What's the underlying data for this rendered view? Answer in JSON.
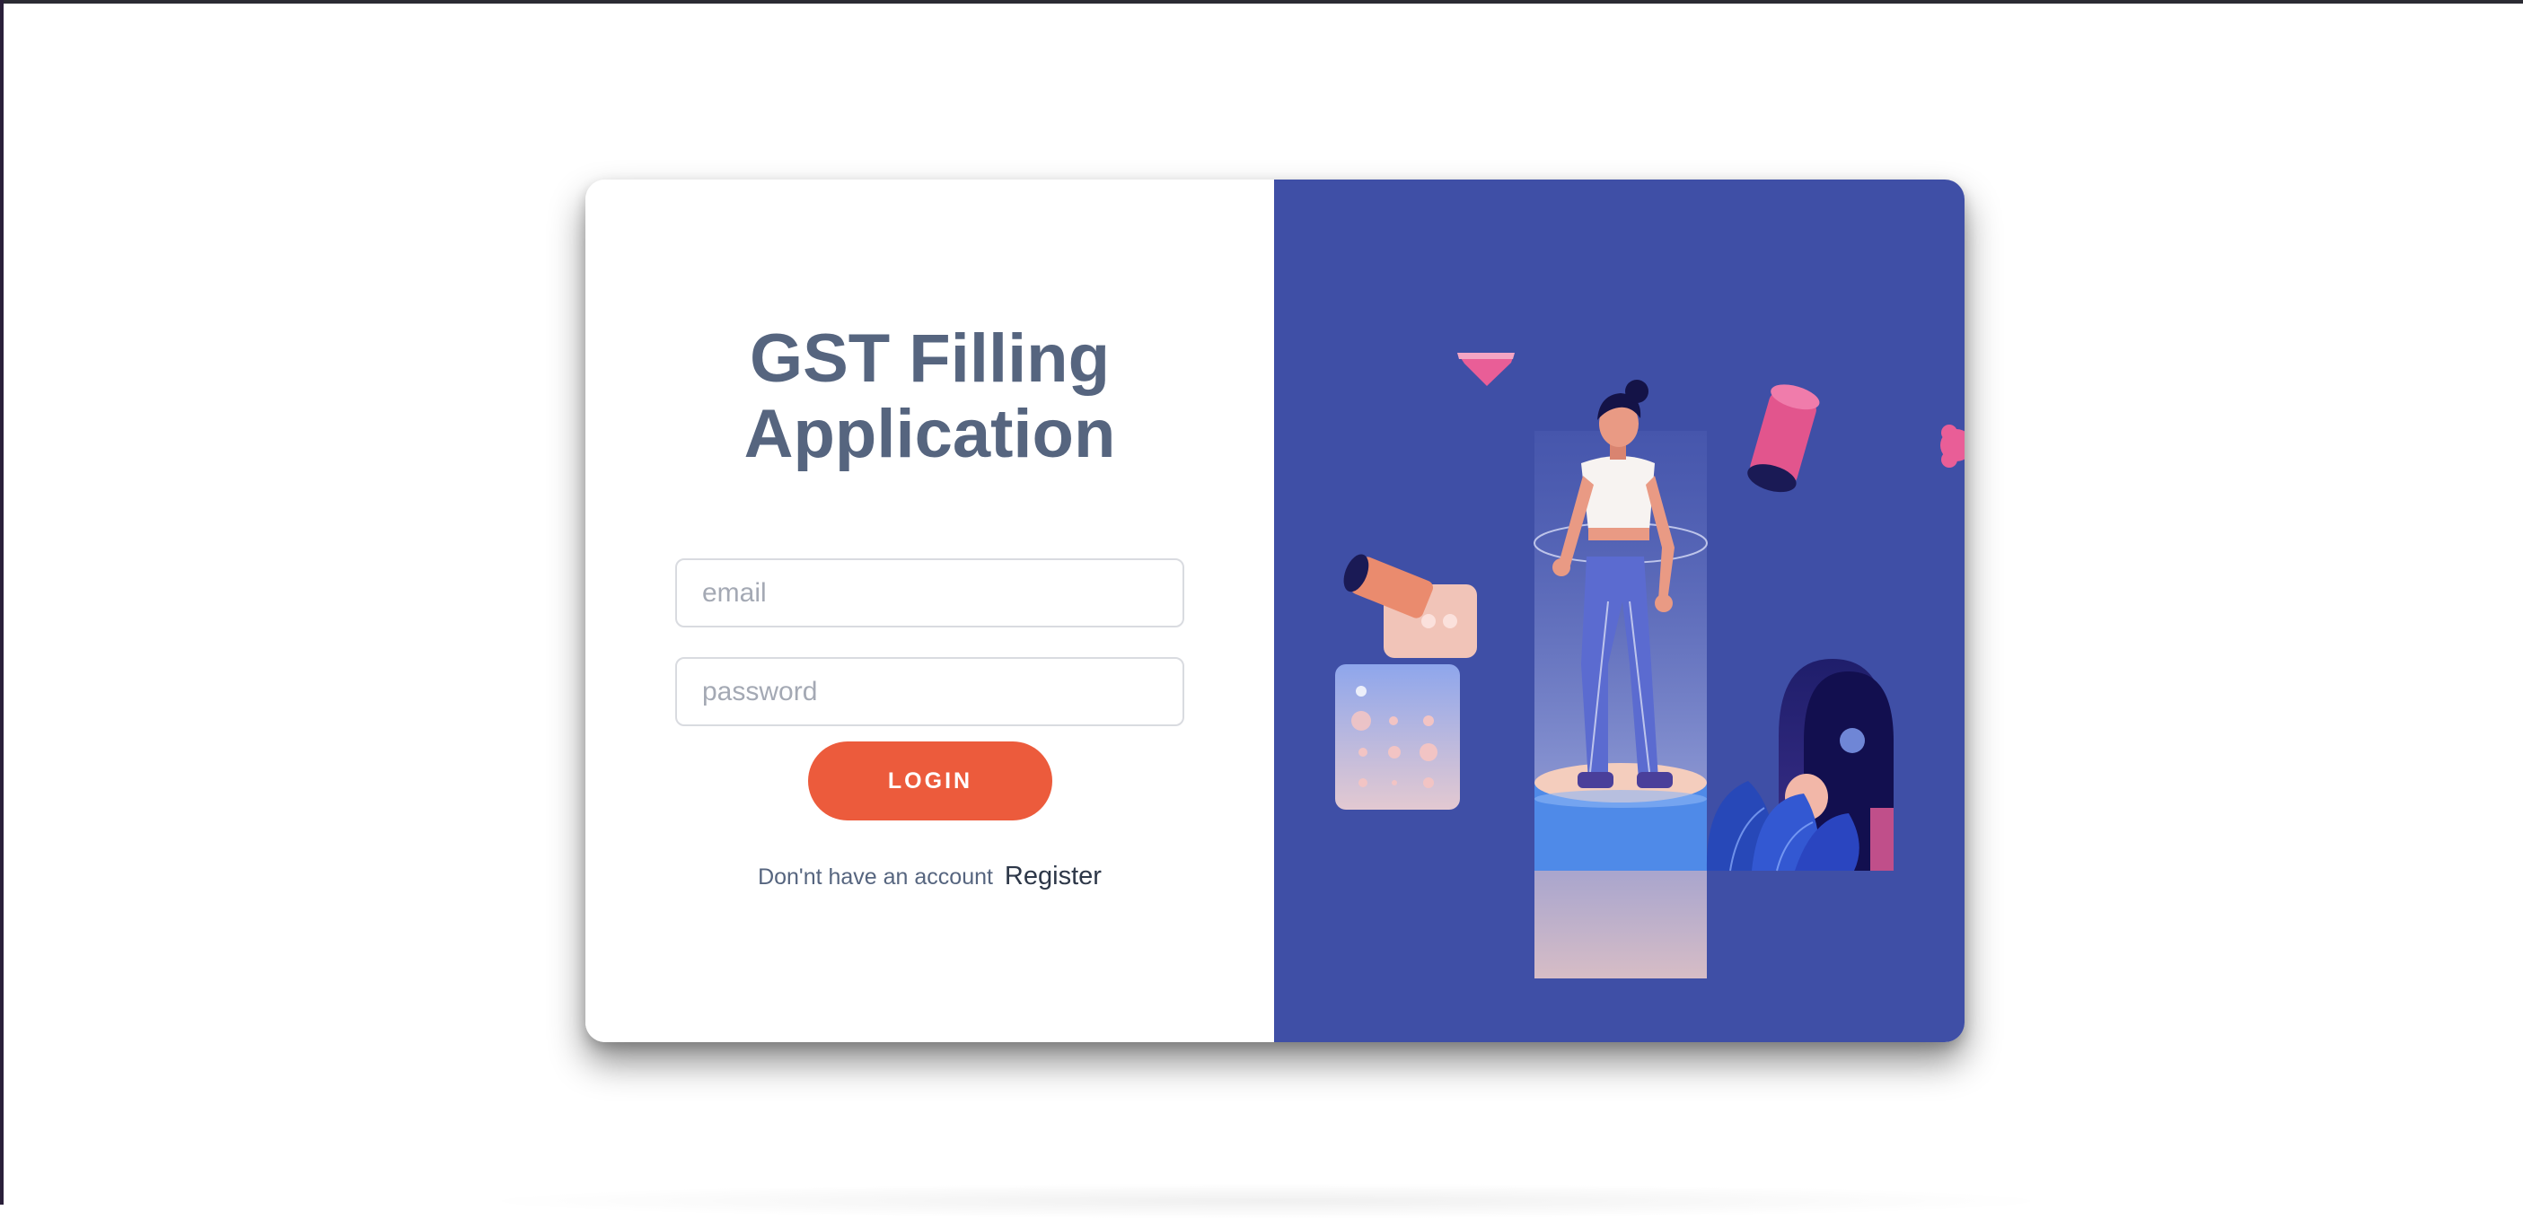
{
  "login": {
    "title_line1": "GST Filling",
    "title_line2": "Application",
    "email_placeholder": "email",
    "password_placeholder": "password",
    "login_label": "LOGIN",
    "register_prompt": "Don'nt have an account",
    "register_link": "Register"
  },
  "colors": {
    "title": "#56657f",
    "accent_button": "#ec5b3c",
    "illustration_bg": "#3f4fa6"
  },
  "icons": {
    "illustration": "woman-standing-illustration"
  }
}
